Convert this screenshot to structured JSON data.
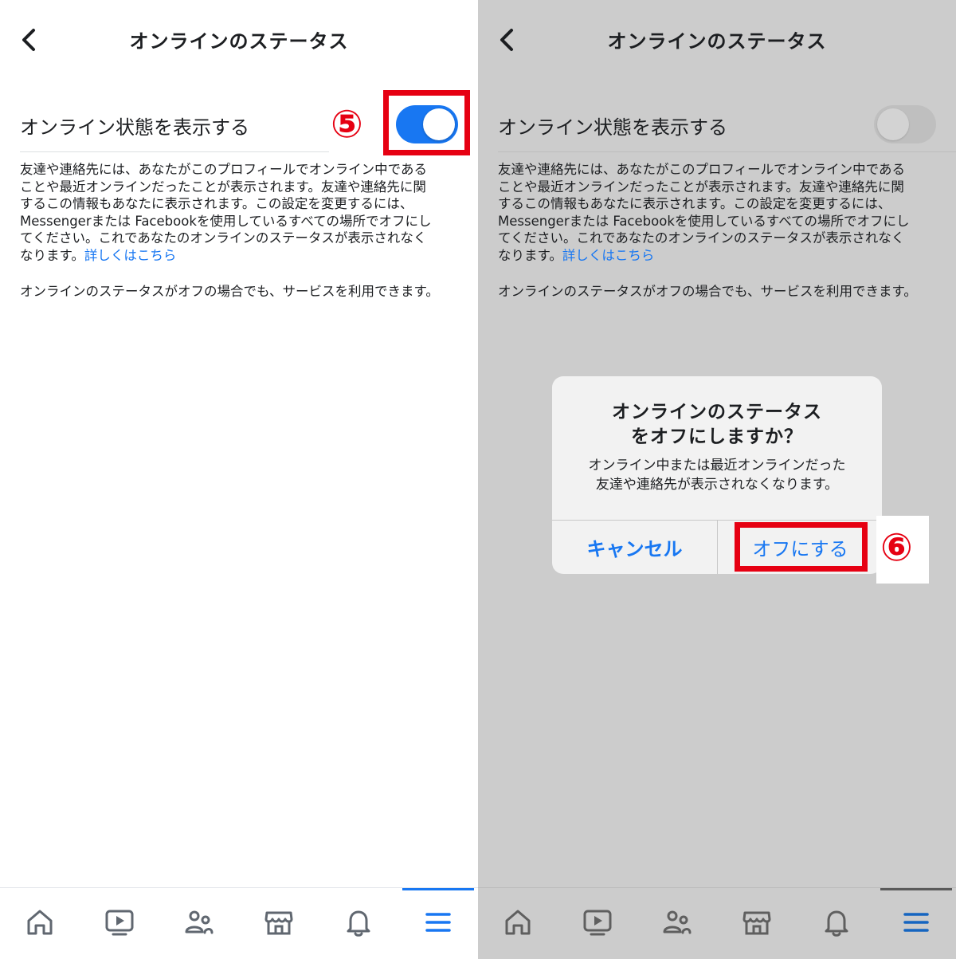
{
  "header": {
    "title": "オンラインのステータス"
  },
  "setting": {
    "label": "オンライン状態を表示する",
    "left_state": "on",
    "right_state": "off"
  },
  "description": {
    "lines": [
      "友達や連絡先には、あなたがこのプロフィールでオンライン中である",
      "ことや最近オンラインだったことが表示されます。友達や連絡先に関",
      "するこの情報もあなたに表示されます。この設定を変更するには、",
      "Messengerまたは Facebookを使用しているすべての場所でオフにし",
      "てください。これであなたのオンラインのステータスが表示されなく"
    ],
    "last_line": "なります。",
    "link": "詳しくはこちら"
  },
  "note": "オンラインのステータスがオフの場合でも、サービスを利用できます。",
  "dialog": {
    "title_line1": "オンラインのステータス",
    "title_line2": "をオフにしますか？",
    "message_line1": "オンライン中または最近オンラインだった",
    "message_line2": "友達や連絡先が表示されなくなります。",
    "cancel_label": "キャンセル",
    "confirm_label": "オフにする"
  },
  "callouts": {
    "step5": "⑤",
    "step6": "⑥"
  },
  "tabs": [
    {
      "name": "home-icon"
    },
    {
      "name": "video-icon"
    },
    {
      "name": "friends-icon"
    },
    {
      "name": "marketplace-icon"
    },
    {
      "name": "bell-icon"
    },
    {
      "name": "menu-icon",
      "active": true
    }
  ],
  "colors": {
    "accent": "#1877f2",
    "callout_red": "#e60012",
    "overlay_gray": "#cccccc",
    "icon_gray": "#606770"
  }
}
